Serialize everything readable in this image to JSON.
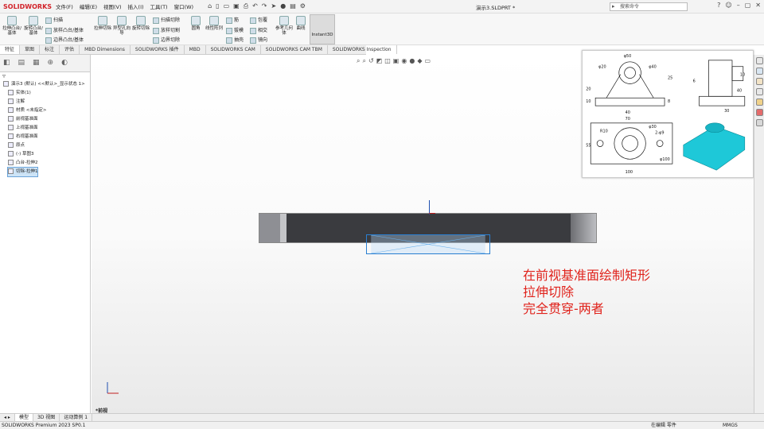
{
  "app": {
    "logo": "SOLIDWORKS",
    "doc_title": "演示3.SLDPRT *"
  },
  "menu": [
    "文件(F)",
    "编辑(E)",
    "视图(V)",
    "插入(I)",
    "工具(T)",
    "窗口(W)"
  ],
  "search": {
    "placeholder": "搜索命令"
  },
  "ribbon": {
    "big": [
      {
        "label": "拉伸凸台/基体"
      },
      {
        "label": "旋转凸台/基体"
      },
      {
        "label": "拉伸切除"
      },
      {
        "label": "异型孔向导"
      },
      {
        "label": "旋转切除"
      },
      {
        "label": "圆角"
      },
      {
        "label": "线性阵列"
      },
      {
        "label": "参考几何体"
      },
      {
        "label": "曲线"
      }
    ],
    "small": [
      {
        "label": "扫描"
      },
      {
        "label": "放样凸台/基体"
      },
      {
        "label": "边界凸台/基体"
      },
      {
        "label": "扫描切除"
      },
      {
        "label": "放样切割"
      },
      {
        "label": "边界切除"
      },
      {
        "label": "筋"
      },
      {
        "label": "拔模"
      },
      {
        "label": "抽壳"
      },
      {
        "label": "包覆"
      },
      {
        "label": "相交"
      },
      {
        "label": "镜向"
      }
    ],
    "instant3d": "Instant3D"
  },
  "tabs": [
    "特征",
    "草图",
    "标注",
    "评估",
    "MBD Dimensions",
    "SOLIDWORKS 插件",
    "MBD",
    "SOLIDWORKS CAM",
    "SOLIDWORKS CAM TBM",
    "SOLIDWORKS Inspection"
  ],
  "tree": [
    {
      "label": "演示3 (默认) <<默认>_显示状态 1>"
    },
    {
      "label": "实体(1)"
    },
    {
      "label": "注解"
    },
    {
      "label": "材质 <未指定>"
    },
    {
      "label": "前视基准面"
    },
    {
      "label": "上视基准面"
    },
    {
      "label": "右视基准面"
    },
    {
      "label": "原点"
    },
    {
      "label": "(-) 草图3"
    },
    {
      "label": "凸台-拉伸2"
    },
    {
      "label": "切除-拉伸1"
    }
  ],
  "ref_drawing": {
    "dims": [
      "φ50",
      "φ20",
      "φ40",
      "40",
      "70",
      "φ30",
      "2-φ9",
      "φ100",
      "100",
      "20",
      "10",
      "8",
      "6",
      "40",
      "30",
      "55",
      "25",
      "R10",
      "10"
    ]
  },
  "annotation": [
    "在前视基准面绘制矩形",
    "拉伸切除",
    "完全贯穿-两者"
  ],
  "view_label": "*前视",
  "bottom_tabs": [
    "模型",
    "3D 视图",
    "运动算例 1"
  ],
  "status": {
    "product": "SOLIDWORKS Premium 2023 SP0.1",
    "mode": "在编辑 零件",
    "units": "MMGS"
  },
  "colors": {
    "logo": "#d2232a",
    "annotation": "#e0231c",
    "sketch": "#2a7fd1",
    "part": "#3a3b3f",
    "iso_part": "#1ec8d8"
  }
}
